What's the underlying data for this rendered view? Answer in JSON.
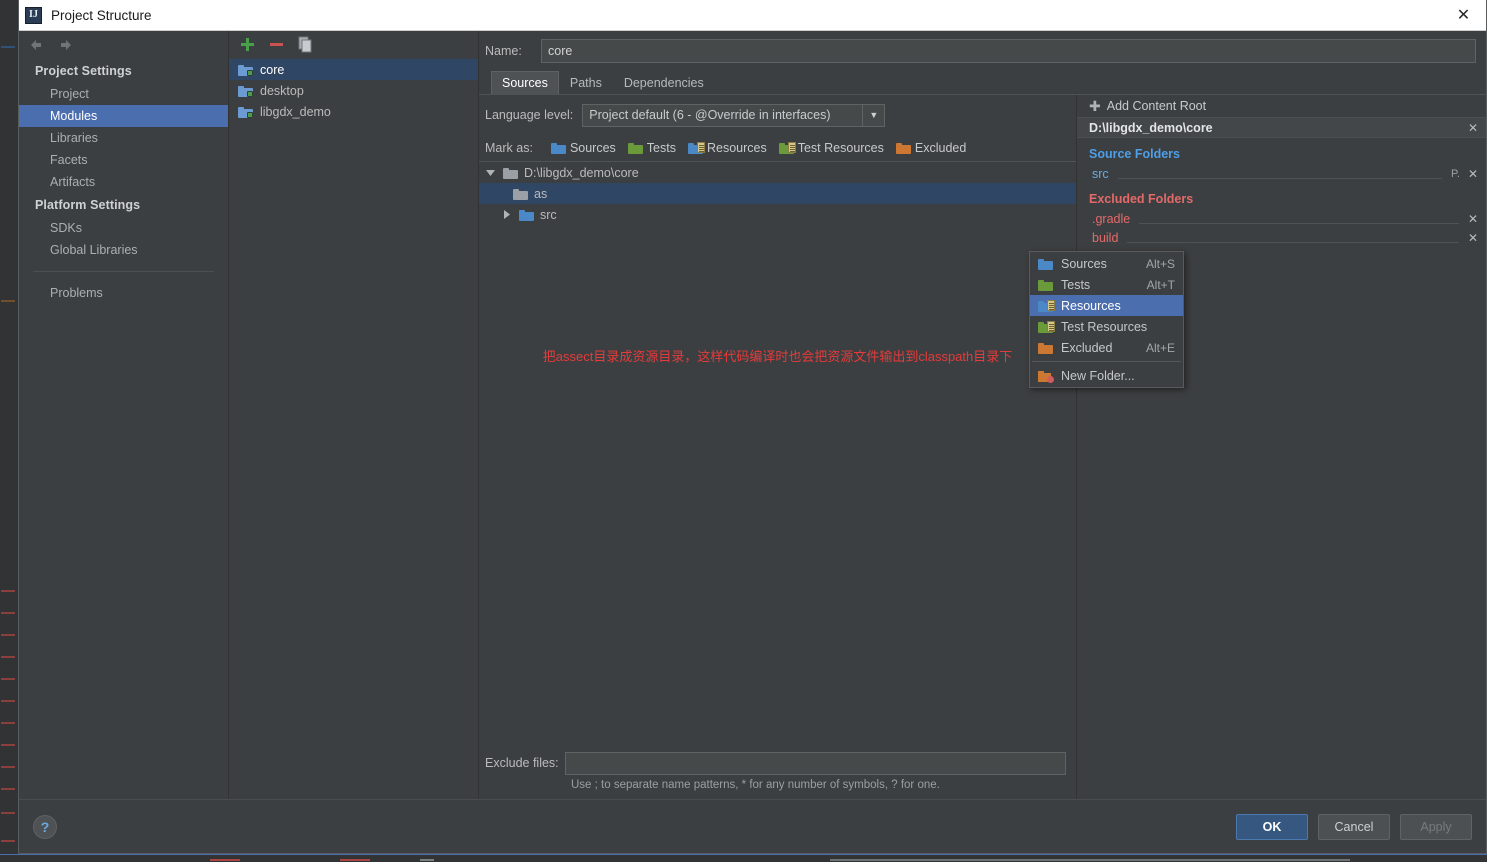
{
  "window": {
    "title": "Project Structure",
    "icon": "intellij-idea-icon",
    "close_label": "✕"
  },
  "sidebar": {
    "nav": {
      "back": "back-arrow-icon",
      "forward": "forward-arrow-icon"
    },
    "groups": [
      {
        "label": "Project Settings",
        "items": [
          {
            "label": "Project",
            "selected": false
          },
          {
            "label": "Modules",
            "selected": true
          },
          {
            "label": "Libraries",
            "selected": false
          },
          {
            "label": "Facets",
            "selected": false
          },
          {
            "label": "Artifacts",
            "selected": false
          }
        ]
      },
      {
        "label": "Platform Settings",
        "items": [
          {
            "label": "SDKs",
            "selected": false
          },
          {
            "label": "Global Libraries",
            "selected": false
          }
        ]
      }
    ],
    "problems_label": "Problems"
  },
  "modules": {
    "toolbar": {
      "add": "add-icon",
      "remove": "remove-icon",
      "copy": "copy-icon"
    },
    "items": [
      {
        "label": "core",
        "selected": true
      },
      {
        "label": "desktop",
        "selected": false
      },
      {
        "label": "libgdx_demo",
        "selected": false
      }
    ]
  },
  "main": {
    "name_label": "Name:",
    "name_value": "core",
    "tabs": [
      {
        "label": "Sources",
        "active": true
      },
      {
        "label": "Paths",
        "active": false
      },
      {
        "label": "Dependencies",
        "active": false
      }
    ],
    "language_level_label": "Language level:",
    "language_level_value": "Project default (6 - @Override in interfaces)",
    "mark_as_label": "Mark as:",
    "mark_as_options": [
      {
        "label": "Sources",
        "icon": "folder-blue-icon"
      },
      {
        "label": "Tests",
        "icon": "folder-green-icon"
      },
      {
        "label": "Resources",
        "icon": "folder-resources-icon"
      },
      {
        "label": "Test Resources",
        "icon": "folder-test-resources-icon"
      },
      {
        "label": "Excluded",
        "icon": "folder-orange-icon"
      }
    ],
    "tree": [
      {
        "label": "D:\\libgdx_demo\\core",
        "twisty": "expanded",
        "depth": 0,
        "selected": false
      },
      {
        "label": "as",
        "twisty": "none",
        "depth": 1,
        "selected": true
      },
      {
        "label": "src",
        "twisty": "collapsed",
        "depth": 1,
        "selected": false
      }
    ],
    "annotation": "把assect目录成资源目录，这样代码编译时也会把资源文件输出到classpath目录下",
    "annotation_color": "#e43b3b",
    "exclude_files_label": "Exclude files:",
    "exclude_files_value": "",
    "exclude_files_hint": "Use ; to separate name patterns, * for any number of symbols, ? for one."
  },
  "context_menu": {
    "items": [
      {
        "label": "Sources",
        "accel": "Alt+S",
        "icon": "folder-blue-icon",
        "selected": false
      },
      {
        "label": "Tests",
        "accel": "Alt+T",
        "icon": "folder-green-icon",
        "selected": false
      },
      {
        "label": "Resources",
        "accel": "",
        "icon": "folder-resources-icon",
        "selected": true
      },
      {
        "label": "Test Resources",
        "accel": "",
        "icon": "folder-test-resources-icon",
        "selected": false
      },
      {
        "label": "Excluded",
        "accel": "Alt+E",
        "icon": "folder-orange-icon",
        "selected": false
      }
    ],
    "new_folder_label": "New Folder...",
    "new_folder_icon": "new-folder-icon",
    "highlight_color": "#4b6eaf"
  },
  "content_roots": {
    "add_label": "Add Content Root",
    "add_icon": "plus-icon",
    "root_path": "D:\\libgdx_demo\\core",
    "root_remove": "✕",
    "source_folders_label": "Source Folders",
    "source_folders_color": "#4e9ee8",
    "source_folders": [
      {
        "name": "src",
        "package_prefix": "P.",
        "remove": "✕"
      }
    ],
    "excluded_folders_label": "Excluded Folders",
    "excluded_folders_color": "#e46a6a",
    "excluded_folders": [
      {
        "name": ".gradle",
        "remove": "✕"
      },
      {
        "name": "build",
        "remove": "✕"
      }
    ]
  },
  "footer": {
    "help_label": "?",
    "buttons": [
      {
        "label": "OK",
        "style": "primary"
      },
      {
        "label": "Cancel",
        "style": "normal"
      },
      {
        "label": "Apply",
        "style": "disabled"
      }
    ]
  }
}
